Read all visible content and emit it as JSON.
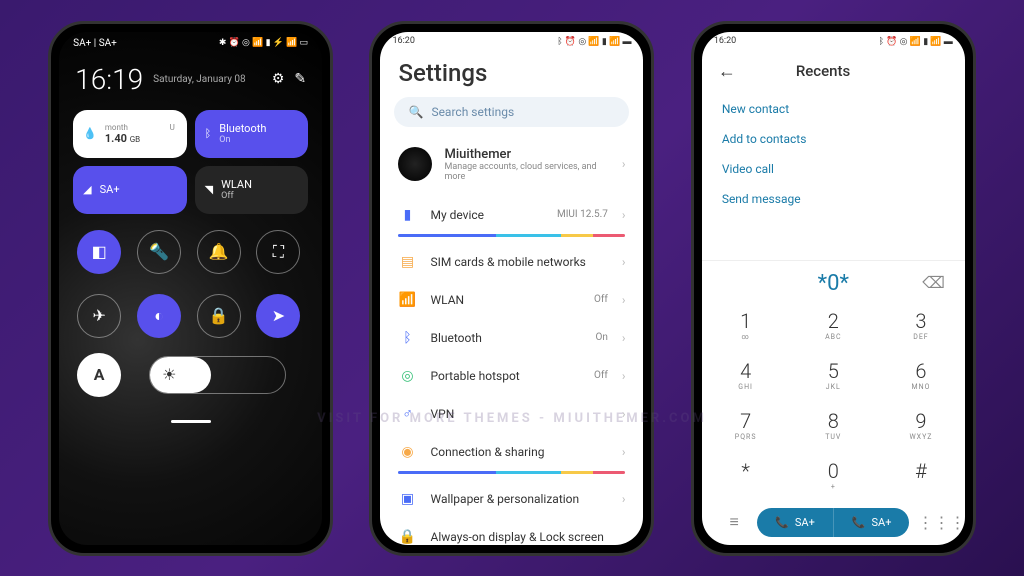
{
  "watermark": "VISIT FOR MORE THEMES - MIUITHEMER.COM",
  "phone1": {
    "status_left": "SA+ | SA+",
    "time": "16:19",
    "date": "Saturday, January 08",
    "tiles": {
      "data": {
        "month": "month",
        "amount": "1.40",
        "unit": "GB",
        "suffix": "U"
      },
      "bluetooth": {
        "label": "Bluetooth",
        "state": "On"
      },
      "sim": {
        "label": "SA+"
      },
      "wlan": {
        "label": "WLAN",
        "state": "Off"
      }
    },
    "auto_label": "A"
  },
  "phone2": {
    "status_time": "16:20",
    "title": "Settings",
    "search_placeholder": "Search settings",
    "account": {
      "name": "Miuithemer",
      "sub": "Manage accounts, cloud services, and more"
    },
    "rows": {
      "device": {
        "label": "My device",
        "value": "MIUI 12.5.7"
      },
      "sim": {
        "label": "SIM cards & mobile networks"
      },
      "wlan": {
        "label": "WLAN",
        "value": "Off"
      },
      "bt": {
        "label": "Bluetooth",
        "value": "On"
      },
      "hotspot": {
        "label": "Portable hotspot",
        "value": "Off"
      },
      "vpn": {
        "label": "VPN"
      },
      "conn": {
        "label": "Connection & sharing"
      },
      "wallpaper": {
        "label": "Wallpaper & personalization"
      },
      "aod": {
        "label": "Always-on display & Lock screen"
      }
    }
  },
  "phone3": {
    "status_time": "16:20",
    "title": "Recents",
    "menu": [
      "New contact",
      "Add to contacts",
      "Video call",
      "Send message"
    ],
    "dialed": "*0*",
    "keys": [
      {
        "n": "1",
        "s": "∞"
      },
      {
        "n": "2",
        "s": "ABC"
      },
      {
        "n": "3",
        "s": "DEF"
      },
      {
        "n": "4",
        "s": "GHI"
      },
      {
        "n": "5",
        "s": "JKL"
      },
      {
        "n": "6",
        "s": "MNO"
      },
      {
        "n": "7",
        "s": "PQRS"
      },
      {
        "n": "8",
        "s": "TUV"
      },
      {
        "n": "9",
        "s": "WXYZ"
      },
      {
        "n": "*",
        "s": ""
      },
      {
        "n": "0",
        "s": "+"
      },
      {
        "n": "#",
        "s": ""
      }
    ],
    "call_label": "SA+"
  }
}
